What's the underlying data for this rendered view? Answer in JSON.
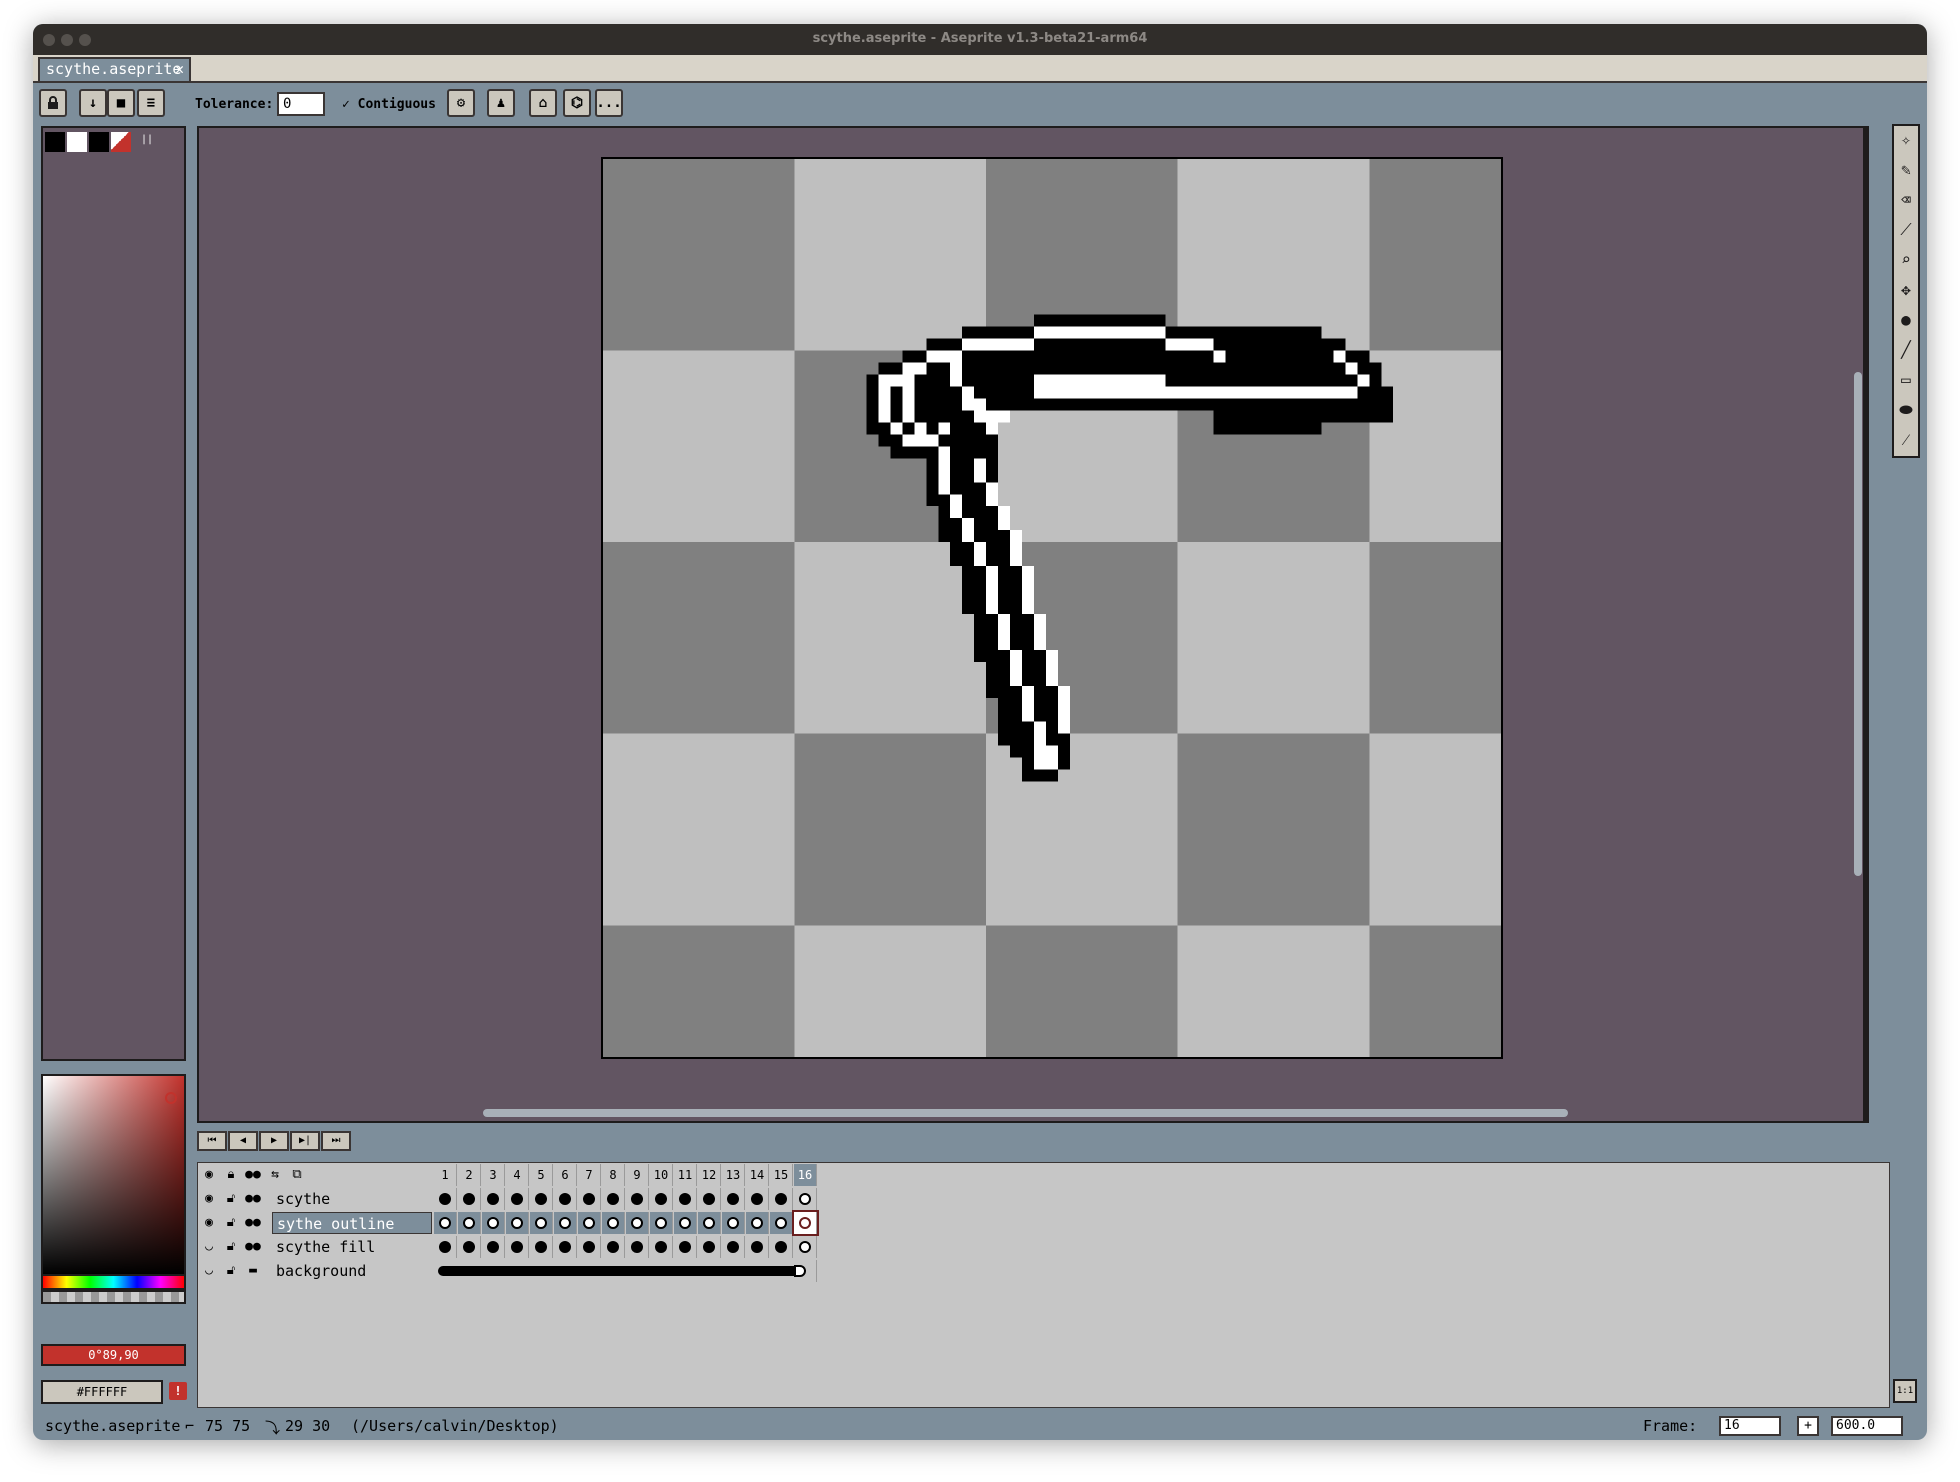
{
  "window": {
    "title": "scythe.aseprite - Aseprite v1.3-beta21-arm64"
  },
  "tabs": [
    {
      "label": "scythe.aseprite",
      "close": "✕"
    }
  ],
  "toolbar": {
    "tolerance_label": "Tolerance:",
    "tolerance_value": "0",
    "contiguous_label": "Contiguous",
    "more_label": "..."
  },
  "palette": {
    "swatches": [
      "#000000",
      "#ffffff",
      "#000000",
      "#c2322c"
    ]
  },
  "color": {
    "hsv_label": "0°89,90",
    "hex_label": "#FFFFFF",
    "warning": "!"
  },
  "canvas": {
    "zoom": "600.0%"
  },
  "timeline": {
    "frames": [
      "1",
      "2",
      "3",
      "4",
      "5",
      "6",
      "7",
      "8",
      "9",
      "10",
      "11",
      "12",
      "13",
      "14",
      "15",
      "16"
    ],
    "current_frame": "16",
    "layers": [
      {
        "name": "scythe",
        "visible": true,
        "cels": "filled"
      },
      {
        "name": "sythe outline",
        "visible": true,
        "cels": "empty",
        "selected": true
      },
      {
        "name": "scythe fill",
        "visible": false,
        "cels": "filled"
      },
      {
        "name": "background",
        "visible": false,
        "cels": "continuous"
      }
    ]
  },
  "statusbar": {
    "filename": "scythe.aseprite",
    "size": "75 75",
    "cursor": "29 30",
    "path": "(/Users/calvin/Desktop)",
    "frame_label": "Frame:",
    "frame_value": "16",
    "add_frame": "+",
    "zoom_value": "600.0"
  },
  "icons": {
    "lock": "lock-icon",
    "eye": "eye-icon",
    "onion": "onion-skin-icon",
    "tools": [
      "magic-wand-icon",
      "pencil-icon",
      "eraser-icon",
      "eyedropper-icon",
      "zoom-icon",
      "move-icon",
      "fill-icon",
      "line-icon",
      "rectangle-icon",
      "ellipse-icon",
      "blur-icon"
    ]
  },
  "playback": [
    "⏮",
    "◀",
    "▶",
    "▶|",
    "⏭"
  ],
  "one_to_one": "1:1"
}
